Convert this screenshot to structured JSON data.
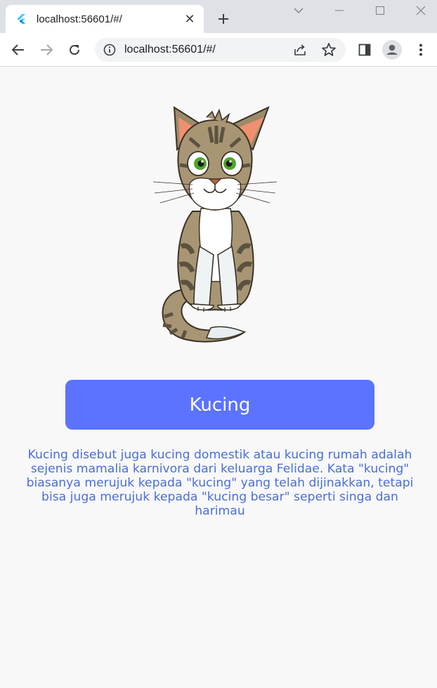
{
  "browser": {
    "tab": {
      "title": "localhost:56601/#/",
      "favicon": "flutter-icon"
    },
    "new_tab_icon": "plus-icon",
    "window_controls": [
      "chevron-down-icon",
      "minimize-icon",
      "maximize-icon",
      "close-icon"
    ],
    "toolbar": {
      "back_icon": "back-arrow-icon",
      "forward_icon": "forward-arrow-icon",
      "reload_icon": "reload-icon",
      "address": "localhost:56601/#/",
      "site_info_icon": "info-icon",
      "share_icon": "share-icon",
      "bookmark_icon": "star-icon",
      "side_panel_icon": "side-panel-icon",
      "profile_icon": "profile-avatar-icon",
      "menu_icon": "kebab-menu-icon"
    }
  },
  "page": {
    "image": "cat-cartoon-illustration",
    "button_label": "Kucing",
    "description": "Kucing disebut juga kucing domestik atau kucing rumah adalah sejenis mamalia karnivora dari keluarga Felidae. Kata \"kucing\" biasanya merujuk kepada \"kucing\" yang telah dijinakkan, tetapi bisa juga merujuk kepada \"kucing besar\" seperti singa dan harimau"
  },
  "colors": {
    "button": "#5b73ff",
    "description_text": "#4a6ed8",
    "page_background": "#f8f8f8"
  }
}
